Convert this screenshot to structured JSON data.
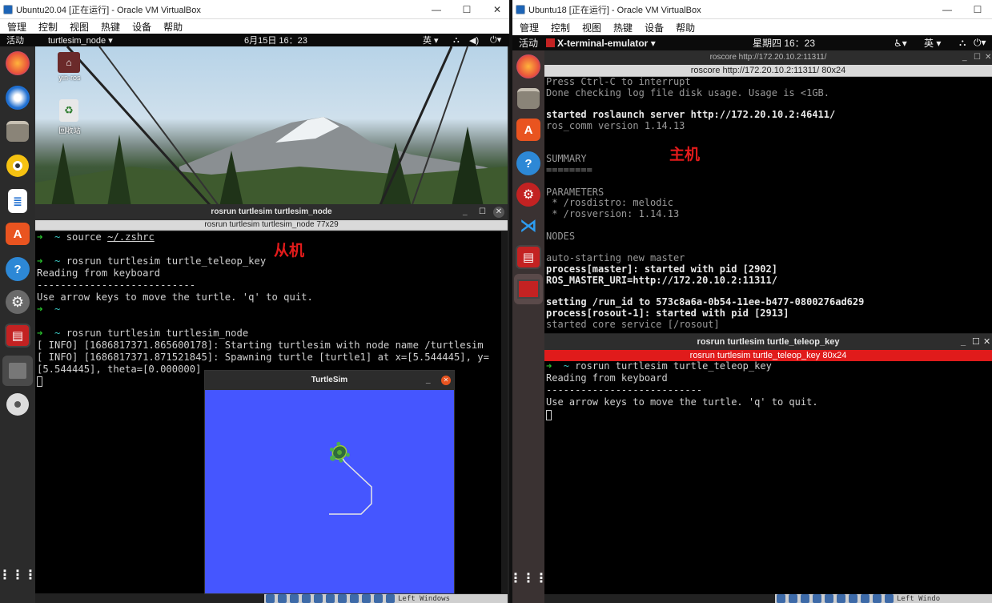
{
  "left_vm": {
    "window_title": "Ubuntu20.04 [正在运行] - Oracle VM VirtualBox",
    "window_controls": [
      "—",
      "☐",
      "✕"
    ],
    "menu": [
      "管理",
      "控制",
      "视图",
      "热键",
      "设备",
      "帮助"
    ],
    "topbar": {
      "activities": "活动",
      "app_menu": "turtlesim_node ▾",
      "clock": "6月15日  16：23",
      "input_method": "英 ▾"
    },
    "desktop_icons": [
      {
        "label": "yin-ros"
      },
      {
        "label": "回收站"
      }
    ],
    "terminal": {
      "title": "rosrun turtlesim turtlesim_node",
      "tab": "rosrun turtlesim turtlesim_node 77x29",
      "lines": [
        {
          "arrow": "➜",
          "tilde": "~",
          "text": "source ",
          "path": "~/.zshrc"
        },
        {
          "blank": ""
        },
        {
          "arrow": "➜",
          "tilde": "~",
          "text": "rosrun turtlesim turtle_teleop_key"
        },
        {
          "plain": "Reading from keyboard"
        },
        {
          "plain": "---------------------------"
        },
        {
          "plain": "Use arrow keys to move the turtle. 'q' to quit."
        },
        {
          "arrow": "➜",
          "tilde": "~",
          "text": ""
        },
        {
          "blank": ""
        },
        {
          "arrow": "➜",
          "tilde": "~",
          "text": "rosrun turtlesim turtlesim_node"
        },
        {
          "plain": "[ INFO] [1686817371.865600178]: Starting turtlesim with node name /turtlesim"
        },
        {
          "plain": "[ INFO] [1686817371.871521845]: Spawning turtle [turtle1] at x=[5.544445], y="
        },
        {
          "plain": "[5.544445], theta=[0.000000]"
        }
      ]
    },
    "annotation": "从机",
    "turtlesim": {
      "title": "TurtleSim",
      "bg_color": "#4556ff"
    },
    "statusbar": "Left Windows"
  },
  "right_vm": {
    "window_title": "Ubuntu18 [正在运行] - Oracle VM VirtualBox",
    "window_controls": [
      "—",
      "☐"
    ],
    "menu": [
      "管理",
      "控制",
      "视图",
      "热键",
      "设备",
      "帮助"
    ],
    "topbar": {
      "activities": "活动",
      "app_menu": "X-terminal-emulator ▾",
      "clock": "星期四 16：23",
      "input_method": "英 ▾"
    },
    "roscore_terminal": {
      "title": "roscore http://172.20.10.2:11311/",
      "tab": "roscore http://172.20.10.2:11311/ 80x24",
      "lines": [
        {
          "t": "Press Ctrl-C to interrupt",
          "s": "gr"
        },
        {
          "t": "Done checking log file disk usage. Usage is <1GB.",
          "s": "gr"
        },
        {
          "t": "",
          "s": "gr"
        },
        {
          "t": "started roslaunch server http://172.20.10.2:46411/",
          "s": "b"
        },
        {
          "t": "ros_comm version 1.14.13",
          "s": "gr"
        },
        {
          "t": "",
          "s": "gr"
        },
        {
          "t": "",
          "s": "gr"
        },
        {
          "t": "SUMMARY",
          "s": "gr"
        },
        {
          "t": "========",
          "s": "gr"
        },
        {
          "t": "",
          "s": "gr"
        },
        {
          "t": "PARAMETERS",
          "s": "gr"
        },
        {
          "t": " * /rosdistro: melodic",
          "s": "gr"
        },
        {
          "t": " * /rosversion: 1.14.13",
          "s": "gr"
        },
        {
          "t": "",
          "s": "gr"
        },
        {
          "t": "NODES",
          "s": "gr"
        },
        {
          "t": "",
          "s": "gr"
        },
        {
          "t": "auto-starting new master",
          "s": "gr"
        },
        {
          "t": "process[master]: started with pid [2902]",
          "s": "b"
        },
        {
          "t": "ROS_MASTER_URI=http://172.20.10.2:11311/",
          "s": "b"
        },
        {
          "t": "",
          "s": "gr"
        },
        {
          "t": "setting /run_id to 573c8a6a-0b54-11ee-b477-0800276ad629",
          "s": "b"
        },
        {
          "t": "process[rosout-1]: started with pid [2913]",
          "s": "b"
        },
        {
          "t": "started core service [/rosout]",
          "s": "gr"
        }
      ]
    },
    "annotation": "主机",
    "teleop_terminal": {
      "title": "rosrun turtlesim turtle_teleop_key",
      "tab": "rosrun turtlesim turtle_teleop_key 80x24",
      "lines": [
        {
          "arrow": "➜",
          "tilde": "~",
          "text": "rosrun turtlesim turtle_teleop_key"
        },
        {
          "plain": "Reading from keyboard"
        },
        {
          "plain": "---------------------------"
        },
        {
          "plain": "Use arrow keys to move the turtle. 'q' to quit."
        }
      ]
    },
    "statusbar": "Left Windo"
  }
}
